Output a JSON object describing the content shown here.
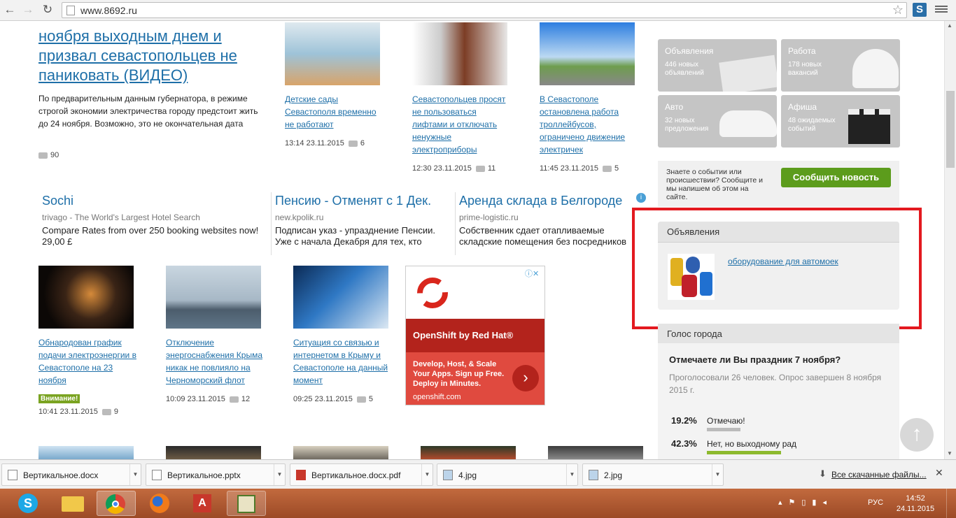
{
  "browser": {
    "url": "www.8692.ru",
    "ext_label": "S"
  },
  "lead": {
    "headline": "ноября выходным днем и призвал севастопольцев не паниковать (ВИДЕО)",
    "text": "По предварительным данным губернатора, в режиме строгой экономии электричества городу предстоит жить до 24 ноября. Возможно, это не окончательная дата",
    "comments": "90"
  },
  "top_news": [
    {
      "title": "Детские сады Севастополя временно не работают",
      "time": "13:14",
      "date": "23.11.2015",
      "comments": "6"
    },
    {
      "title": "Севастопольцев просят не пользоваться лифтами и отключать ненужные электроприборы",
      "time": "12:30",
      "date": "23.11.2015",
      "comments": "11"
    },
    {
      "title": "В Севастополе остановлена работа троллейбусов, ограничено движение электричек",
      "time": "11:45",
      "date": "23.11.2015",
      "comments": "5"
    }
  ],
  "ads": [
    {
      "title": "Sochi",
      "source": "trivago - The World's Largest Hotel Search",
      "text": "Compare Rates from over 250 booking websites now! 29,00 £"
    },
    {
      "title": "Пенсию - Отменят с 1 Дек.",
      "source": "new.kpolik.ru",
      "text": "Подписан указ - упразднение Пенсии. Уже с начала Декабря для тех, кто"
    },
    {
      "title": "Аренда склада в Белгороде",
      "source": "prime-logistic.ru",
      "text": "Собственник сдает отапливаемые складские помещения без посредников"
    }
  ],
  "bottom_news": [
    {
      "title": "Обнародован график подачи электроэнергии в Севастополе на 23 ноября",
      "badge": "Внимание!",
      "time": "10:41",
      "date": "23.11.2015",
      "comments": "9"
    },
    {
      "title": "Отключение энергоснабжения Крыма никак не повлияло на Черноморский флот",
      "time": "10:09",
      "date": "23.11.2015",
      "comments": "12"
    },
    {
      "title": "Ситуация со связью и интернетом в Крыму и Севастополе на данный момент",
      "time": "09:25",
      "date": "23.11.2015",
      "comments": "5"
    }
  ],
  "banner": {
    "title": "OpenShift by Red Hat®",
    "text": "Develop, Host, & Scale Your Apps. Sign up Free. Deploy in Minutes.",
    "domain": "openshift.com"
  },
  "sidebar": {
    "tiles": [
      {
        "title": "Объявления",
        "sub": "446 новых объявлений"
      },
      {
        "title": "Работа",
        "sub": "178 новых вакансий"
      },
      {
        "title": "Авто",
        "sub": "32 новых предложения"
      },
      {
        "title": "Афиша",
        "sub": "48 ожидаемых событий"
      }
    ],
    "report_text": "Знаете о событии или происшествии? Сообщите и мы напишем об этом на сайте.",
    "report_button": "Сообщить новость",
    "ads_heading": "Объявления",
    "ads_link": "оборудование для автомоек",
    "poll_heading": "Голос города",
    "poll_question": "Отмечаете ли Вы праздник 7 ноября?",
    "poll_info": "Проголосовали 26 человек. Опрос завершен 8 ноября 2015 г.",
    "poll_options": [
      {
        "pct": "19.2%",
        "label": "Отмечаю!",
        "value": 19.2
      },
      {
        "pct": "42.3%",
        "label": "Нет, но выходному рад",
        "value": 42.3
      }
    ]
  },
  "downloads": {
    "items": [
      "Вертикальное.docx",
      "Вертикальное.pptx",
      "Вертикальное.docx.pdf",
      "4.jpg",
      "2.jpg"
    ],
    "all_label": "Все скачанные файлы..."
  },
  "taskbar": {
    "lang": "РУС",
    "time": "14:52",
    "date": "24.11.2015"
  },
  "colors": {
    "link": "#1e6fa8",
    "accent_green": "#5c9c1c",
    "highlight_red": "#e3191f",
    "banner_red": "#b3231c"
  }
}
